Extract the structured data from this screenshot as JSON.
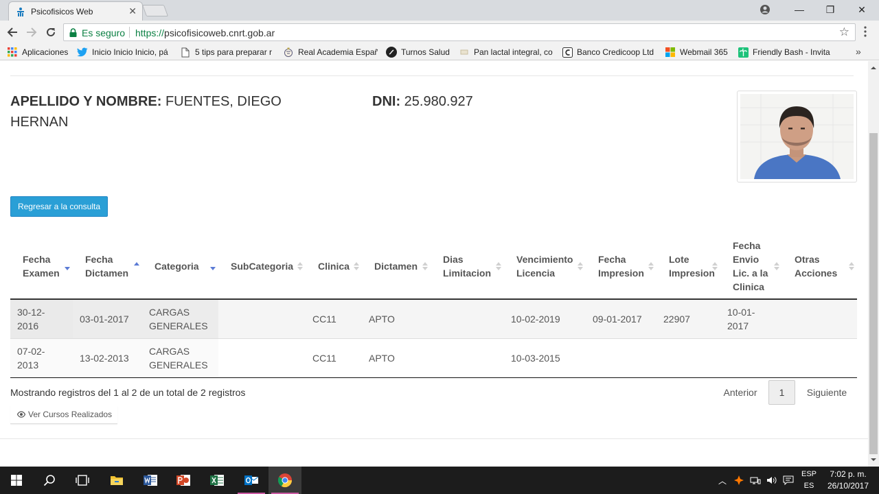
{
  "browser": {
    "tab_title": "Psicofisicos Web",
    "tab_close": "✕",
    "window": {
      "minimize": "—",
      "maximize": "❐",
      "close": "✕"
    },
    "security_label": "Es seguro",
    "url_scheme": "https://",
    "url_host": "psicofisicoweb.cnrt.gob.ar",
    "star": "☆",
    "bookmarks": [
      {
        "label": "Aplicaciones",
        "icon": "apps-grid-icon"
      },
      {
        "label": "Inicio Inicio Inicio, pá",
        "icon": "twitter-icon"
      },
      {
        "label": "5 tips para preparar r",
        "icon": "page-icon"
      },
      {
        "label": "Real Academia Españ",
        "icon": "rae-icon"
      },
      {
        "label": "Turnos Salud",
        "icon": "turnos-icon"
      },
      {
        "label": "Pan lactal integral, co",
        "icon": "recipe-icon"
      },
      {
        "label": "Banco Credicoop Ltd",
        "icon": "credicoop-icon"
      },
      {
        "label": "Webmail 365",
        "icon": "microsoft-icon"
      },
      {
        "label": "Friendly Bash - Invita",
        "icon": "palm-icon"
      }
    ],
    "bookmarks_more": "»"
  },
  "person": {
    "name_label": "APELLIDO Y NOMBRE:",
    "name_value": "FUENTES, DIEGO HERNAN",
    "dni_label": "DNI:",
    "dni_value": "25.980.927"
  },
  "back_button": "Regresar a la consulta",
  "table": {
    "columns": [
      {
        "label": "Fecha Examen",
        "sort": "desc"
      },
      {
        "label": "Fecha Dictamen",
        "sort": "asc"
      },
      {
        "label": "Categoria",
        "sort": "desc"
      },
      {
        "label": "SubCategoria",
        "sort": "none"
      },
      {
        "label": "Clinica",
        "sort": "none"
      },
      {
        "label": "Dictamen",
        "sort": "none"
      },
      {
        "label": "Dias Limitacion",
        "sort": "none"
      },
      {
        "label": "Vencimiento Licencia",
        "sort": "none"
      },
      {
        "label": "Fecha Impresion",
        "sort": "none"
      },
      {
        "label": "Lote Impresion",
        "sort": "none"
      },
      {
        "label": "Fecha Envio Lic. a la Clinica",
        "sort": "none"
      },
      {
        "label": "Otras Acciones",
        "sort": "none"
      }
    ],
    "rows": [
      [
        "30-12-2016",
        "03-01-2017",
        "CARGAS GENERALES",
        "",
        "CC11",
        "APTO",
        "",
        "10-02-2019",
        "09-01-2017",
        "22907",
        "10-01-2017",
        ""
      ],
      [
        "07-02-2013",
        "13-02-2013",
        "CARGAS GENERALES",
        "",
        "CC11",
        "APTO",
        "",
        "10-03-2015",
        "",
        "",
        "",
        ""
      ]
    ]
  },
  "info_text": "Mostrando registros del 1 al 2 de un total de 2 registros",
  "pagination": {
    "prev": "Anterior",
    "current": "1",
    "next": "Siguiente"
  },
  "courses_button": "Ver Cursos Realizados",
  "taskbar": {
    "tray_chevron": "︿",
    "lang_top": "ESP",
    "lang_bottom": "ES",
    "time": "7:02 p. m.",
    "date": "26/10/2017"
  },
  "colors": {
    "primary": "#2a9fd6",
    "secure_green": "#0b8043",
    "sort_active": "#5b7bd5"
  }
}
